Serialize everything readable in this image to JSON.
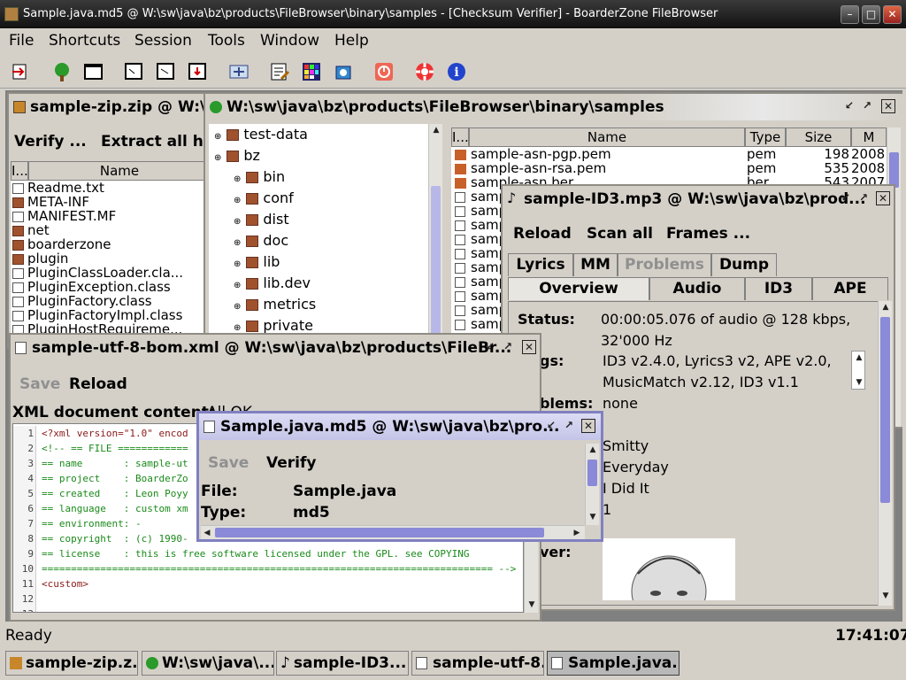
{
  "titlebar": {
    "title": "Sample.java.md5 @ W:\\sw\\java\\bz\\products\\FileBrowser\\binary\\samples - [Checksum Verifier] - BoarderZone FileBrowser"
  },
  "menu": {
    "file": "File",
    "shortcuts": "Shortcuts",
    "session": "Session",
    "tools": "Tools",
    "window": "Window",
    "help": "Help"
  },
  "zip": {
    "title": "sample-zip.zip @ W:\\s",
    "verify": "Verify ...",
    "extract": "Extract all he",
    "col_icon": "I...",
    "col_name": "Name",
    "items": [
      "Readme.txt",
      "META-INF",
      "MANIFEST.MF",
      "net",
      "boarderzone",
      "plugin",
      "PluginClassLoader.cla...",
      "PluginException.class",
      "PluginFactory.class",
      "PluginFactoryImpl.class",
      "PluginHostRequireme..."
    ]
  },
  "browser": {
    "title": "W:\\sw\\java\\bz\\products\\FileBrowser\\binary\\samples",
    "tree": [
      "test-data",
      "bz",
      "bin",
      "conf",
      "dist",
      "doc",
      "lib",
      "lib.dev",
      "metrics",
      "private"
    ],
    "col_icon": "I...",
    "col_name": "Name",
    "col_type": "Type",
    "col_size": "Size",
    "col_m": "M",
    "files": [
      {
        "name": "sample-asn-pgp.pem",
        "type": "pem",
        "size": "198",
        "date": "2008"
      },
      {
        "name": "sample-asn-rsa.pem",
        "type": "pem",
        "size": "535",
        "date": "2008"
      },
      {
        "name": "sample-asn.ber",
        "type": "ber",
        "size": "543",
        "date": "2007"
      }
    ],
    "short_files": [
      "samp",
      "samp",
      "samp",
      "samp",
      "samp",
      "samp",
      "samp",
      "samp",
      "samp",
      "samp",
      "samp"
    ]
  },
  "mp3": {
    "title": "sample-ID3.mp3 @ W:\\sw\\java\\bz\\prod...",
    "reload": "Reload",
    "scan": "Scan all",
    "frames": "Frames ...",
    "tabs1": {
      "lyrics": "Lyrics",
      "mm": "MM",
      "problems": "Problems",
      "dump": "Dump"
    },
    "tabs2": {
      "overview": "Overview",
      "audio": "Audio",
      "id3": "ID3",
      "ape": "APE"
    },
    "status_label": "Status:",
    "status_value": "00:00:05.076 of audio @ 128 kbps,",
    "status_value2": "32'000 Hz",
    "tags_label": "gs:",
    "tags_value": "ID3 v2.4.0, Lyrics3 v2, APE v2.0,",
    "tags_value2": "MusicMatch v2.12, ID3 v1.1",
    "problems_label": "blems:",
    "problems_value": "none",
    "artist": "Smitty",
    "album": "Everyday",
    "track_title": "I Did It",
    "track": "1",
    "cover_label": "ver:"
  },
  "xml": {
    "title": "sample-utf-8-bom.xml @ W:\\sw\\java\\bz\\products\\FileBr...",
    "save": "Save",
    "reload": "Reload",
    "content_label": "XML document content:",
    "content_value": "All OK",
    "lines": [
      "1",
      "2",
      "3",
      "4",
      "5",
      "6",
      "7",
      "8",
      "9",
      "10",
      "11",
      "12",
      "13"
    ],
    "code": [
      "<?xml version=\"1.0\" encod",
      "<!-- == FILE ============",
      "== name       : sample-ut",
      "== project    : BoarderZo",
      "== created    : Leon Poyy",
      "== language   : custom xm",
      "== environment: -",
      "== copyright  : (c) 1990-",
      "== license    : this is free software licensed under the GPL. see COPYING",
      "============================================================================= -->",
      "<custom>",
      "",
      ""
    ]
  },
  "md5": {
    "title": "Sample.java.md5 @ W:\\sw\\java\\bz\\pro...",
    "save": "Save",
    "verify": "Verify",
    "file_label": "File:",
    "file_value": "Sample.java",
    "type_label": "Type:",
    "type_value": "md5"
  },
  "status": {
    "text": "Ready",
    "clock": "17:41:07"
  },
  "taskbar": {
    "t1": "sample-zip.z...",
    "t2": "W:\\sw\\java\\...",
    "t3": "sample-ID3....",
    "t4": "sample-utf-8...",
    "t5": "Sample.java..."
  }
}
